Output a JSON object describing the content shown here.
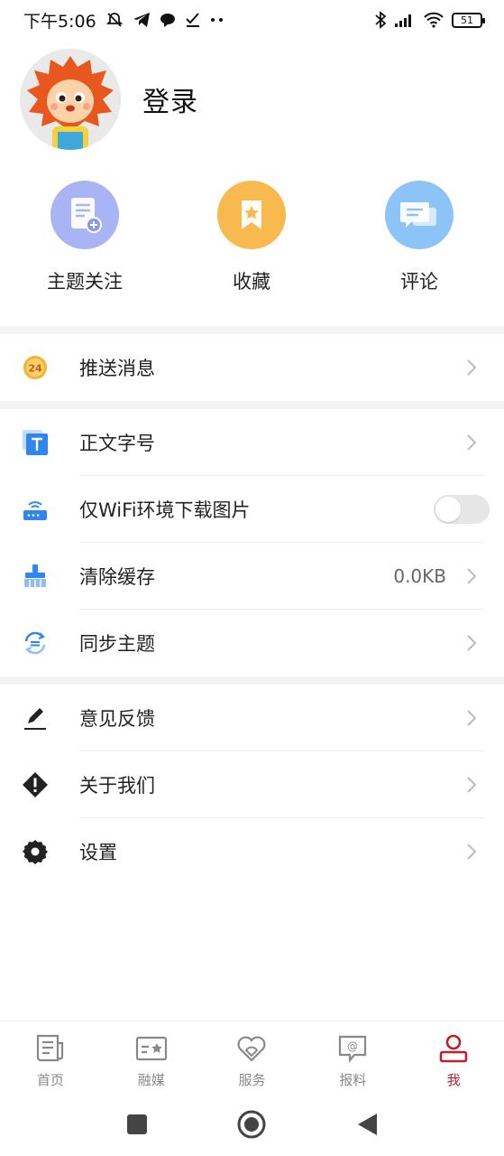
{
  "status_bar": {
    "time": "下午5:06",
    "battery": "51",
    "icons": [
      "mute-bell-icon",
      "telegram-icon",
      "chat-icon",
      "check-icon",
      "more-dots-icon",
      "bluetooth-icon",
      "signal-icon",
      "wifi-icon",
      "battery-icon"
    ]
  },
  "profile": {
    "login_label": "登录",
    "avatar": "lion-mascot-avatar"
  },
  "shortcuts": [
    {
      "label": "主题关注",
      "icon": "topic-follow-icon",
      "color": "#a9b4f5"
    },
    {
      "label": "收藏",
      "icon": "bookmark-icon",
      "color": "#f8b94f"
    },
    {
      "label": "评论",
      "icon": "comment-icon",
      "color": "#8cc4f8"
    }
  ],
  "menu": {
    "push": {
      "label": "推送消息",
      "icon": "push-24-icon"
    },
    "font_size": {
      "label": "正文字号",
      "icon": "font-t-icon"
    },
    "wifi_images": {
      "label": "仅WiFi环境下载图片",
      "icon": "router-icon",
      "enabled": false
    },
    "clear_cache": {
      "label": "清除缓存",
      "value": "0.0KB",
      "icon": "broom-icon"
    },
    "sync_theme": {
      "label": "同步主题",
      "icon": "sync-icon"
    },
    "feedback": {
      "label": "意见反馈",
      "icon": "pen-icon"
    },
    "about": {
      "label": "关于我们",
      "icon": "info-diamond-icon"
    },
    "settings": {
      "label": "设置",
      "icon": "gear-icon"
    }
  },
  "tabs": [
    {
      "label": "首页",
      "icon": "newspaper-icon",
      "active": false
    },
    {
      "label": "融媒",
      "icon": "media-card-icon",
      "active": false
    },
    {
      "label": "服务",
      "icon": "heart-service-icon",
      "active": false
    },
    {
      "label": "报料",
      "icon": "report-at-icon",
      "active": false
    },
    {
      "label": "我",
      "icon": "user-icon",
      "active": true
    }
  ],
  "colors": {
    "accent": "#c0202a",
    "divider": "#ececec",
    "section_bg": "#f4f4f4"
  }
}
